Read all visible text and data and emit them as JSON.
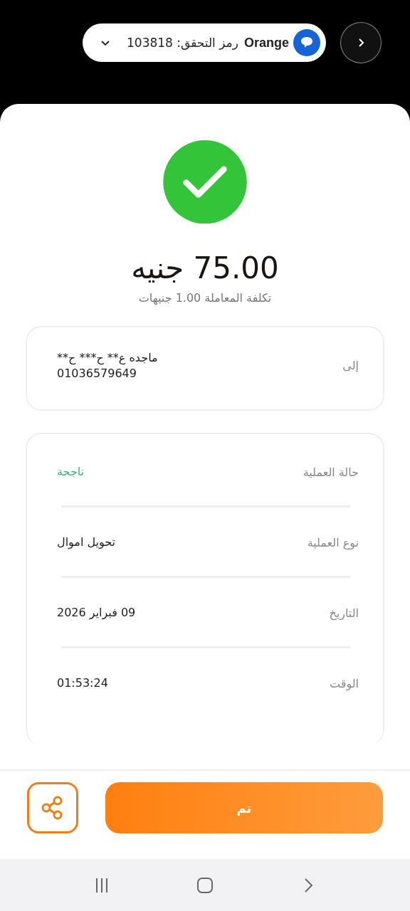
{
  "notification": {
    "sender": "Orange",
    "message": "رمز التحقق: 103818",
    "expanded": false
  },
  "amount": "75.00 جنيه",
  "fee": "تكلفة المعاملة 1.00 جنيهات",
  "recipient": {
    "label": "إلى",
    "name": "ماجده ع** ح*** ح**",
    "phone": "01036579649"
  },
  "details": [
    {
      "label": "حالة العملية",
      "value": "ناجحة",
      "kind": "status"
    },
    {
      "label": "نوع العملية",
      "value": "تحويل اموال",
      "kind": "text"
    },
    {
      "label": "التاريخ",
      "value": "09 فبراير 2026",
      "kind": "text"
    },
    {
      "label": "الوقت",
      "value": "01:53:24",
      "kind": "text"
    }
  ],
  "done_button": "تم"
}
